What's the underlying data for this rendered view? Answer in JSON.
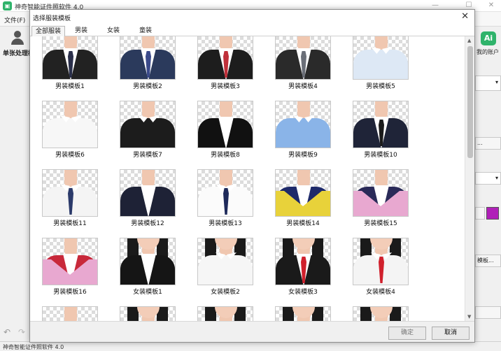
{
  "app": {
    "title": "神奇智能证件照软件 4.0",
    "menu_file": "文件(F)",
    "left_panel_label": "单张处理模",
    "status_text": "神奇智能证件照软件 4.0",
    "account_label": "我的账户",
    "ai_badge": "Ai",
    "template_btn_label": "模板...",
    "right_dots": "...",
    "accent_color": "#b020b8"
  },
  "dialog": {
    "title": "选择服装模板",
    "close_icon": "close-icon",
    "tabs": [
      {
        "label": "全部服装",
        "active": true
      },
      {
        "label": "男装",
        "active": false
      },
      {
        "label": "女装",
        "active": false
      },
      {
        "label": "童装",
        "active": false
      }
    ],
    "templates": [
      {
        "label": "男装模板1",
        "style": "suit",
        "jacket": "#222222",
        "tie": "#2a2f4a"
      },
      {
        "label": "男装模板2",
        "style": "suit",
        "jacket": "#2b3a5c",
        "tie": "#3b4a8a"
      },
      {
        "label": "男装模板3",
        "style": "suit",
        "jacket": "#1d1d1d",
        "tie": "#c0303a"
      },
      {
        "label": "男装模板4",
        "style": "suit",
        "jacket": "#2a2a2a",
        "tie": "#6b6f78"
      },
      {
        "label": "男装模板5",
        "style": "shirt",
        "jacket": "#dde8f5",
        "tie": ""
      },
      {
        "label": "男装模板6",
        "style": "shirt",
        "jacket": "#f7f7f7",
        "tie": ""
      },
      {
        "label": "男装模板7",
        "style": "shirt",
        "jacket": "#1c1c1c",
        "tie": ""
      },
      {
        "label": "男装模板8",
        "style": "suit",
        "jacket": "#111111",
        "tie": ""
      },
      {
        "label": "男装模板9",
        "style": "shirt",
        "jacket": "#8ab4e8",
        "tie": ""
      },
      {
        "label": "男装模板10",
        "style": "suit",
        "jacket": "#1f2438",
        "tie": "#1a1a1a"
      },
      {
        "label": "男装模板11",
        "style": "shirt",
        "jacket": "#f4f4f4",
        "tie": "#2b3a6a"
      },
      {
        "label": "男装模板12",
        "style": "suit",
        "jacket": "#1e2236",
        "tie": ""
      },
      {
        "label": "男装模板13",
        "style": "shirt",
        "jacket": "#fbfbfb",
        "tie": "#1e2a5a"
      },
      {
        "label": "男装模板14",
        "style": "gown",
        "jacket": "#1e2a6a",
        "tie": "#e8d23a"
      },
      {
        "label": "男装模板15",
        "style": "gown",
        "jacket": "#2a2a58",
        "tie": "#e8a8d0"
      },
      {
        "label": "男装模板16",
        "style": "gown",
        "jacket": "#c8283a",
        "tie": "#e8a8d0"
      },
      {
        "label": "女装模板1",
        "style": "women-suit",
        "jacket": "#151515",
        "tie": ""
      },
      {
        "label": "女装模板2",
        "style": "women-shirt",
        "jacket": "#f6f6f6",
        "tie": ""
      },
      {
        "label": "女装模板3",
        "style": "women-suit",
        "jacket": "#1a1a1a",
        "tie": "#d0202c"
      },
      {
        "label": "女装模板4",
        "style": "women-shirt",
        "jacket": "#f4f4f4",
        "tie": "#d0202c"
      },
      {
        "label": "",
        "style": "gown",
        "jacket": "#1e2a6a",
        "tie": "#e8a8d0"
      },
      {
        "label": "",
        "style": "women-suit",
        "jacket": "#151515",
        "tie": ""
      },
      {
        "label": "",
        "style": "women-suit",
        "jacket": "#151515",
        "tie": ""
      },
      {
        "label": "",
        "style": "women-suit",
        "jacket": "#151515",
        "tie": ""
      },
      {
        "label": "",
        "style": "women-suit",
        "jacket": "#151515",
        "tie": ""
      }
    ],
    "ok_label": "确定",
    "cancel_label": "取消"
  }
}
